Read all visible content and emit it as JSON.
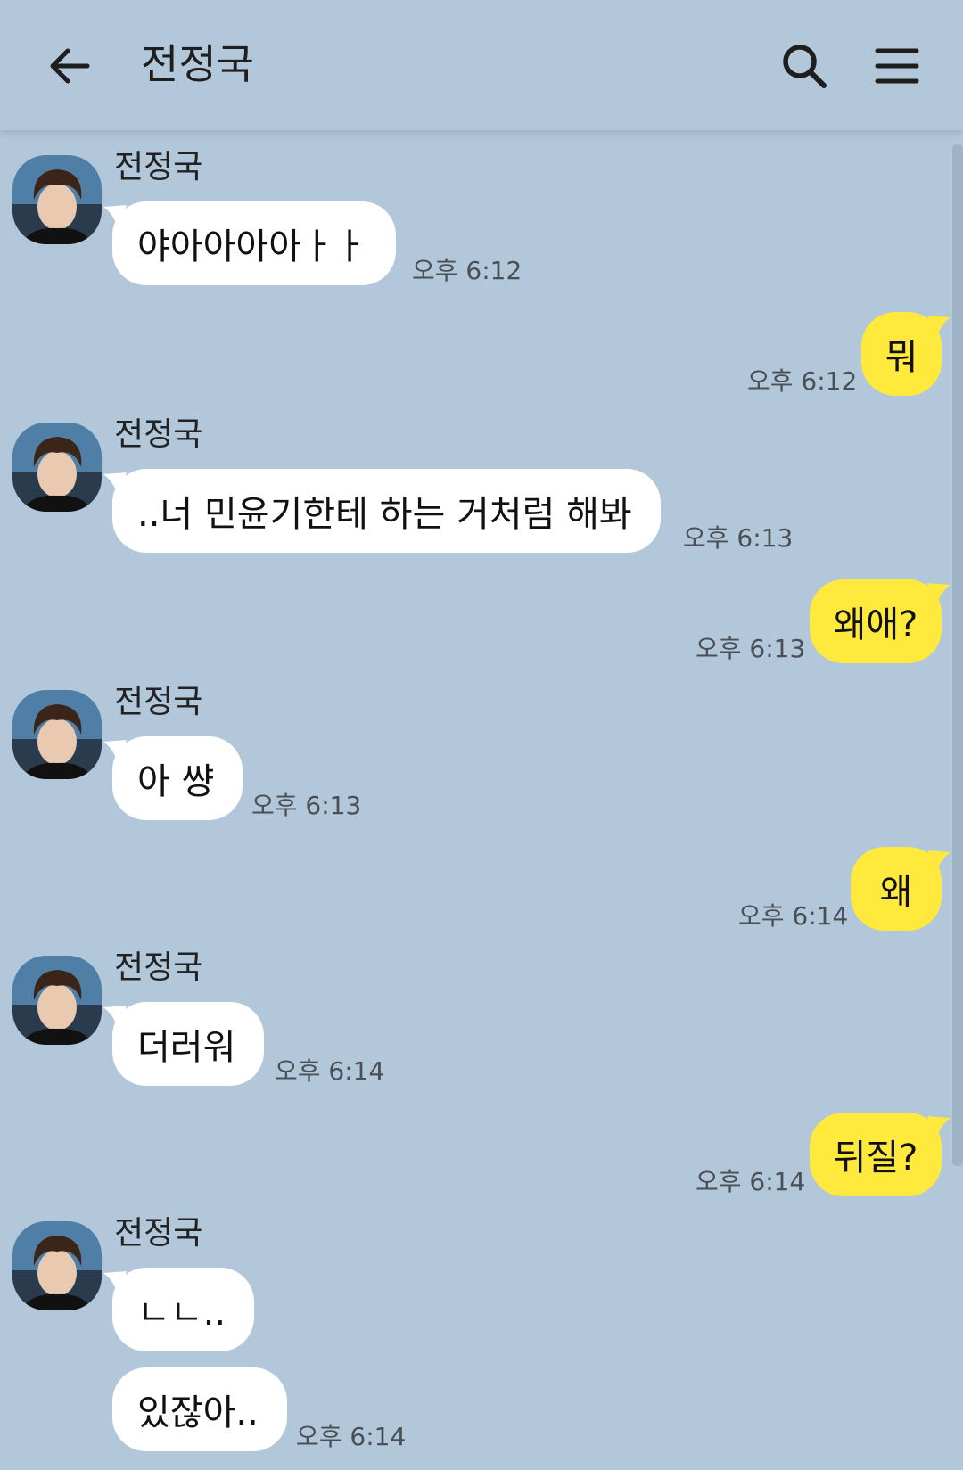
{
  "header": {
    "title": "전정국"
  },
  "icons": {
    "back": "arrow-left-icon",
    "search": "search-icon",
    "menu": "hamburger-menu-icon"
  },
  "colors": {
    "background": "#b2c7da",
    "incoming_bubble": "#ffffff",
    "outgoing_bubble": "#fee93c"
  },
  "messages": [
    {
      "direction": "incoming",
      "sender": "전정국",
      "text": "야아아아아ㅏㅏ",
      "time": "오후 6:12"
    },
    {
      "direction": "outgoing",
      "text": "뭐",
      "time": "오후 6:12"
    },
    {
      "direction": "incoming",
      "sender": "전정국",
      "text": "..너 민윤기한테 하는 거처럼 해봐",
      "time": "오후 6:13"
    },
    {
      "direction": "outgoing",
      "text": "왜애?",
      "time": "오후 6:13"
    },
    {
      "direction": "incoming",
      "sender": "전정국",
      "text": "아 썅",
      "time": "오후 6:13"
    },
    {
      "direction": "outgoing",
      "text": "왜",
      "time": "오후 6:14"
    },
    {
      "direction": "incoming",
      "sender": "전정국",
      "text": "더러워",
      "time": "오후 6:14"
    },
    {
      "direction": "outgoing",
      "text": "뒤질?",
      "time": "오후 6:14"
    },
    {
      "direction": "incoming",
      "sender": "전정국",
      "text": "ㄴㄴ..",
      "time": ""
    },
    {
      "direction": "incoming",
      "text": "있잖아..",
      "time": "오후 6:14"
    }
  ]
}
